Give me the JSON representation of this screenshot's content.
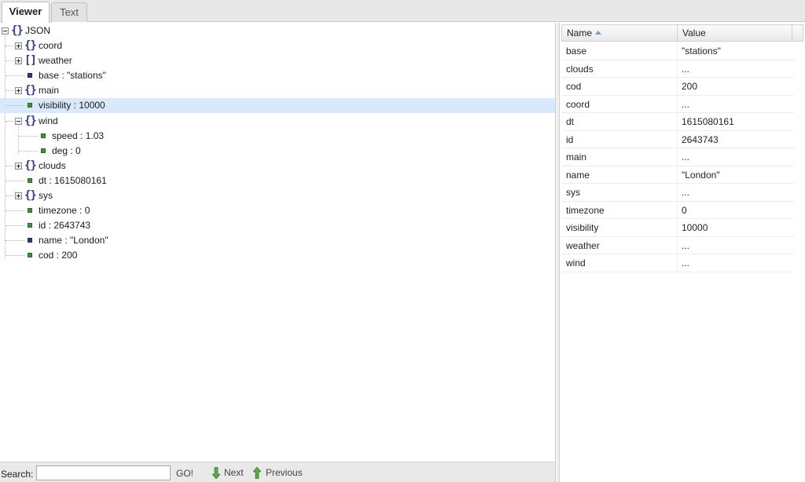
{
  "tabs": [
    {
      "label": "Viewer",
      "active": true
    },
    {
      "label": "Text",
      "active": false
    }
  ],
  "tree": {
    "root_label": "JSON",
    "nodes": [
      {
        "label": "coord",
        "type": "object",
        "expanded": false
      },
      {
        "label": "weather",
        "type": "array",
        "expanded": false
      },
      {
        "label": "base : \"stations\"",
        "type": "string"
      },
      {
        "label": "main",
        "type": "object",
        "expanded": false
      },
      {
        "label": "visibility : 10000",
        "type": "number",
        "selected": true
      },
      {
        "label": "wind",
        "type": "object",
        "expanded": true
      },
      {
        "label": "speed : 1.03",
        "type": "number",
        "child": true
      },
      {
        "label": "deg : 0",
        "type": "number",
        "child": true
      },
      {
        "label": "clouds",
        "type": "object",
        "expanded": false
      },
      {
        "label": "dt : 1615080161",
        "type": "number"
      },
      {
        "label": "sys",
        "type": "object",
        "expanded": false
      },
      {
        "label": "timezone : 0",
        "type": "number"
      },
      {
        "label": "id : 2643743",
        "type": "number"
      },
      {
        "label": "name : \"London\"",
        "type": "string"
      },
      {
        "label": "cod : 200",
        "type": "number"
      }
    ]
  },
  "search": {
    "label": "Search:",
    "value": "",
    "go_label": "GO!",
    "next_label": "Next",
    "previous_label": "Previous"
  },
  "grid": {
    "header": {
      "name": "Name",
      "value": "Value"
    },
    "rows": [
      {
        "name": "base",
        "value": "\"stations\""
      },
      {
        "name": "clouds",
        "value": "..."
      },
      {
        "name": "cod",
        "value": "200"
      },
      {
        "name": "coord",
        "value": "..."
      },
      {
        "name": "dt",
        "value": "1615080161"
      },
      {
        "name": "id",
        "value": "2643743"
      },
      {
        "name": "main",
        "value": "..."
      },
      {
        "name": "name",
        "value": "\"London\""
      },
      {
        "name": "sys",
        "value": "..."
      },
      {
        "name": "timezone",
        "value": "0"
      },
      {
        "name": "visibility",
        "value": "10000"
      },
      {
        "name": "weather",
        "value": "..."
      },
      {
        "name": "wind",
        "value": "..."
      }
    ]
  },
  "colors": {
    "selection": "#d9e8fb",
    "object_icon": "#2d3a8c",
    "number_leaf": "#3f8f3f",
    "string_leaf": "#2d3a8c",
    "arrow_green": "#5aa84a"
  },
  "icons": {
    "object": "object-braces-icon",
    "array": "array-brackets-icon",
    "number": "number-leaf-icon",
    "string": "string-leaf-icon",
    "next": "arrow-down-icon",
    "previous": "arrow-up-icon",
    "sort": "sort-ascending-icon"
  }
}
